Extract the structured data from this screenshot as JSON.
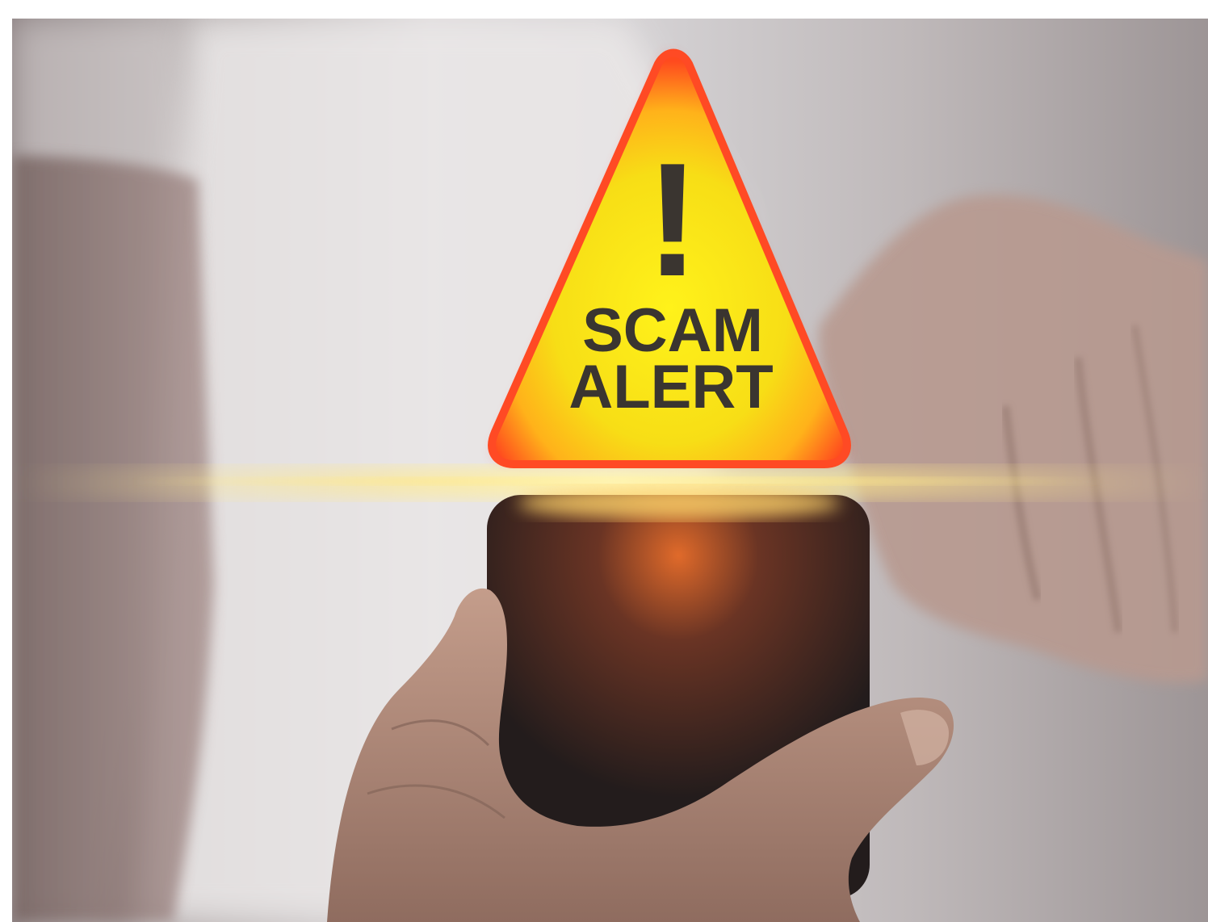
{
  "scene": {
    "description_labels": {
      "sign": "warning-sign",
      "phone": "smartphone"
    },
    "sign": {
      "exclamation": "!",
      "line1": "SCAM",
      "line2": "ALERT"
    },
    "colors": {
      "sign_fill": "#f2e31a",
      "sign_glow": "#ff3a1e",
      "text": "#3a3530",
      "phone": "#2a2322",
      "skin": "#b08a78",
      "shirt": "#e6e2e2",
      "light_beam": "#ffe98a"
    }
  }
}
